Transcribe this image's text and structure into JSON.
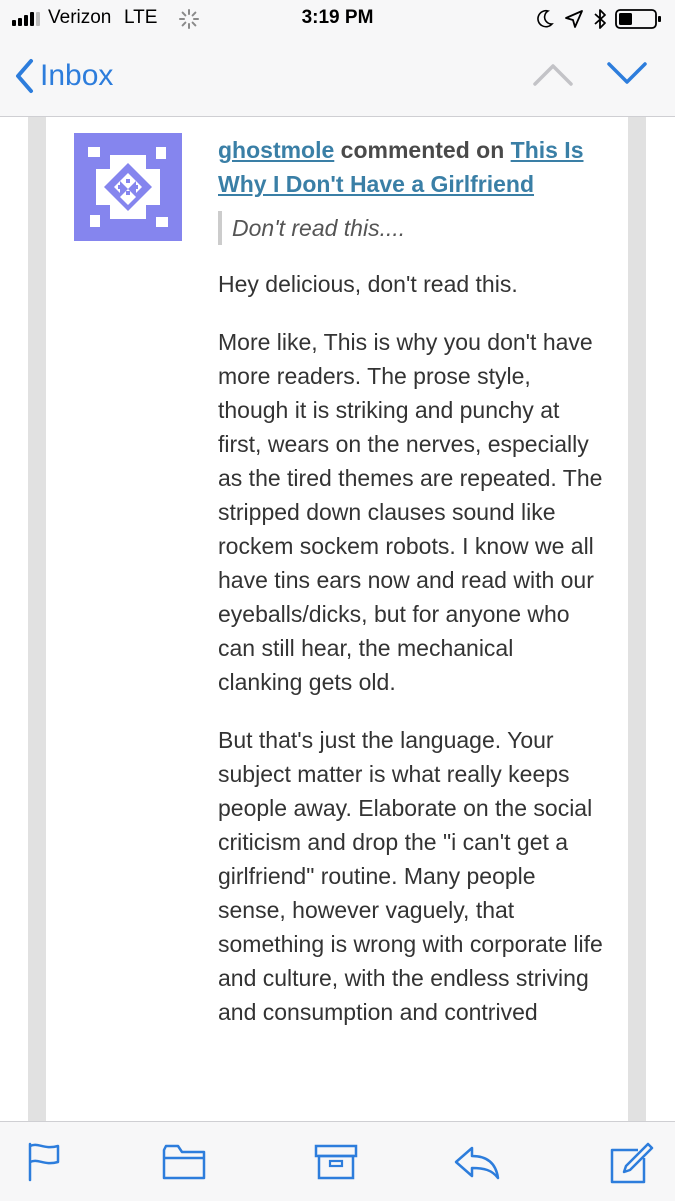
{
  "status_bar": {
    "carrier": "Verizon",
    "network": "LTE",
    "time": "3:19 PM"
  },
  "nav": {
    "back_label": "Inbox",
    "accent_color": "#2d7ddc"
  },
  "comment": {
    "username": "ghostmole",
    "action_text": "commented on",
    "post_title": "This Is Why I Don't Have a Girlfriend",
    "quote": "Don't read this....",
    "paragraphs": [
      "Hey delicious, don't read this.",
      "More like, This is why you don't have more readers. The prose style, though it is striking and punchy at first, wears on the nerves, especially as the tired themes are repeated. The stripped down clauses sound like rockem sockem robots. I know we all have tins ears now and read with our eyeballs/dicks, but for anyone who can still hear, the mechanical clanking gets old.",
      "But that's just the language. Your subject matter is what really keeps people away. Elaborate on the social criticism and drop the \"i can't get a girlfriend\" routine. Many people sense, however vaguely, that something is wrong with corporate life and culture, with the endless striving and consumption and contrived"
    ],
    "avatar_color": "#8585ee",
    "link_color": "#3a7fa6"
  },
  "toolbar": {
    "icons": [
      "flag-icon",
      "folder-icon",
      "archive-icon",
      "reply-icon",
      "compose-icon"
    ]
  }
}
